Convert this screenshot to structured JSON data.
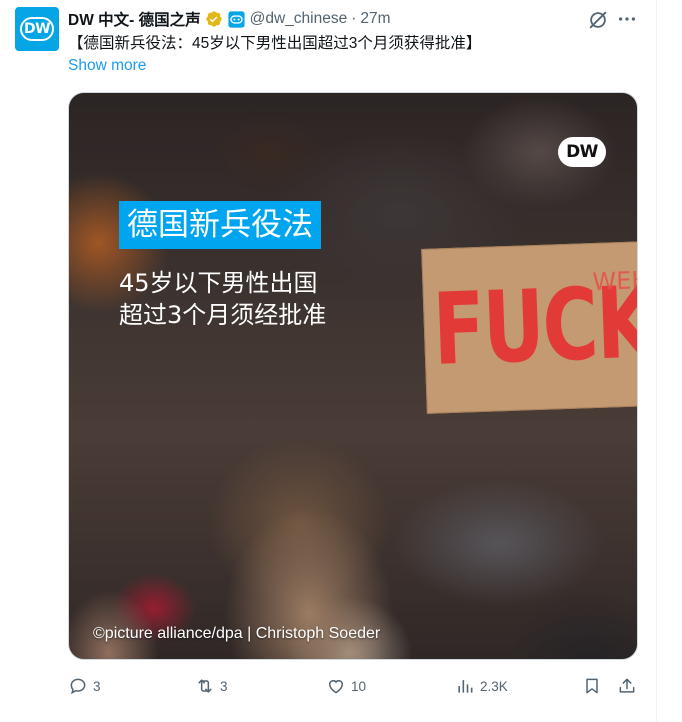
{
  "tweet": {
    "display_name": "DW 中文- 德国之声",
    "handle": "@dw_chinese",
    "separator": "·",
    "time": "27m",
    "text": "【德国新兵役法：45岁以下男性出国超过3个月须获得批准】",
    "show_more": "Show more",
    "avatar_text": "DW"
  },
  "media": {
    "logo_text": "DW",
    "headline": "德国新兵役法",
    "sub_line1": "45岁以下男性出国",
    "sub_line2": "超过3个月须经批准",
    "sign_text": "FUCK",
    "sign_side_text": "WEHR PFLI",
    "credit": "©picture alliance/dpa | Christoph Soeder"
  },
  "actions": {
    "replies": "3",
    "reposts": "3",
    "likes": "10",
    "views": "2.3K"
  },
  "colors": {
    "accent": "#1d9bf0",
    "brand": "#05a5e6",
    "muted": "#536471",
    "verified_gold": "#e2b719"
  },
  "icons": [
    "verified-badge-icon",
    "affiliate-badge-icon",
    "grok-icon",
    "more-icon",
    "reply-icon",
    "repost-icon",
    "like-icon",
    "views-icon",
    "bookmark-icon",
    "share-icon"
  ]
}
